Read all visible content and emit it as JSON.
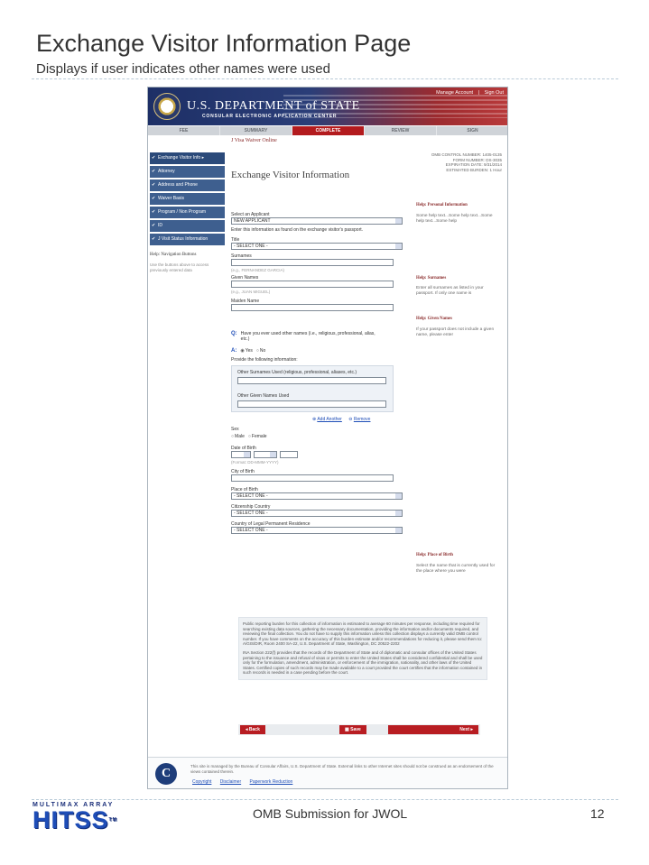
{
  "slide": {
    "title": "Exchange Visitor Information Page",
    "subtitle": "Displays if user indicates other names were used",
    "footer": "OMB Submission for JWOL",
    "page_number": "12",
    "logo_top": "MULTIMAX ARRAY",
    "logo_word": "HITSS",
    "logo_tm": "TM"
  },
  "banner": {
    "department": "U.S. DEPARTMENT of STATE",
    "ceac": "CONSULAR ELECTRONIC APPLICATION CENTER",
    "manage_account": "Manage Account",
    "sign_out": "Sign Out"
  },
  "steps": [
    "FEE",
    "SUMMARY",
    "COMPLETE",
    "REVIEW",
    "SIGN"
  ],
  "sidebar": {
    "items": [
      "Exchange Visitor Info",
      "Attorney",
      "Address and Phone",
      "Waiver Basis",
      "Program / Non Program",
      "ID",
      "J Visit Status Information"
    ],
    "help_title": "Help: Navigation Buttons",
    "help_text": "Use the buttons above to access previously entered data"
  },
  "main": {
    "app_name": "J Visa Waiver Online",
    "omb_lines": [
      "OMB CONTROL NUMBER: 1405-0135",
      "FORM NUMBER: DS-3035",
      "EXPIRATION DATE: 9/31/2014",
      "ESTIMATED BURDEN: 1 Hour"
    ],
    "form_title": "Exchange Visitor Information",
    "select_applicant_label": "Select an Applicant",
    "select_applicant_value": "NEW APPLICANT",
    "passport_note": "Enter this information as found on the exchange visitor's passport.",
    "title_label": "Title",
    "title_value": "- SELECT ONE -",
    "surnames_label": "Surnames",
    "surnames_hint": "(e.g., FERNANDEZ GARCIA)",
    "given_label": "Given Names",
    "given_hint": "(e.g., JUAN MIGUEL)",
    "maiden_label": "Maiden Name",
    "question_marker": "Q:",
    "question": "Have you ever used other names (i.e., religious, professional, alias, etc.)",
    "answer_marker": "A:",
    "yes": "Yes",
    "no": "No",
    "provide_info": "Provide the following information:",
    "other_surnames_label": "Other Surnames Used (religious, professional, aliases, etc.)",
    "other_given_label": "Other Given Names Used",
    "add_another": "Add Another",
    "remove": "Remove",
    "sex_label": "Sex",
    "male": "Male",
    "female": "Female",
    "dob_label": "Date of Birth",
    "dob_hint": "(Format: DD-MMM-YYYY)",
    "city_label": "City of Birth",
    "place_label": "Place of Birth",
    "place_value": "- SELECT ONE -",
    "citizenship_label": "Citizenship Country",
    "citizenship_value": "- SELECT ONE -",
    "residence_label": "Country of Legal Permanent Residence",
    "residence_value": "- SELECT ONE -"
  },
  "help": {
    "personal_title": "Help: Personal Information",
    "personal_text": "Some help text...Some help text...Some help text...Some help",
    "surnames_title": "Help: Surnames",
    "surnames_text": "Enter all surnames as listed in your passport. If only one name is",
    "given_title": "Help: Given Names",
    "given_text": "If your passport does not include a given name, please enter",
    "place_title": "Help: Place of Birth",
    "place_text": "Select the name that is currently used for the place where you were"
  },
  "legal": {
    "burden": "Public reporting burden for this collection of information is estimated to average 60 minutes per response, including time required for searching existing data sources, gathering the necessary documentation, providing the information and/or documents required, and reviewing the final collection. You do not have to supply this information unless this collection displays a currently valid OMB control number. If you have comments on the accuracy of this burden estimate and/or recommendations for reducing it, please send them to: A/GIS/DIR, Room 2400 SA-22, U.S. Department of State, Washington, DC 20522-2202",
    "ina": "INA Section 222(f) provides that the records of the Department of State and of diplomatic and consular offices of the United States pertaining to the issuance and refusal of visas or permits to enter the United States shall be considered confidential and shall be used only for the formulation, amendment, administration, or enforcement of the immigration, nationality, and other laws of the United States. Certified copies of such records may be made available to a court provided the court certifies that the information contained in such records is needed in a case pending before the court."
  },
  "buttons": {
    "back": "Back",
    "save": "Save",
    "next": "Next"
  },
  "site_footer": {
    "seal": "C",
    "text": "This site is managed by the Bureau of Consular Affairs, U.S. Department of State. External links to other Internet sites should not be construed as an endorsement of the views contained therein.",
    "links": [
      "Copyright",
      "Disclaimer",
      "Paperwork Reduction"
    ]
  }
}
